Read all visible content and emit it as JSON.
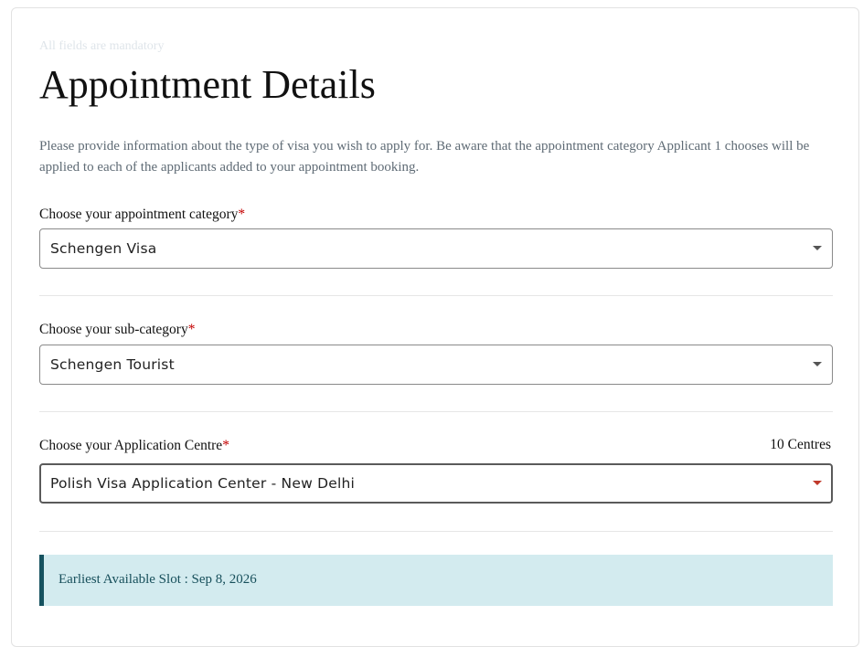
{
  "form": {
    "mandatory_note": "All fields are mandatory",
    "title": "Appointment Details",
    "intro": "Please provide information about the type of visa you wish to apply for. Be aware that the appointment category Applicant 1 chooses will be applied to each of the applicants added to your appointment booking.",
    "required_marker": "*"
  },
  "category": {
    "label": "Choose your appointment category",
    "value": "Schengen Visa"
  },
  "subcategory": {
    "label": "Choose your sub-category",
    "value": "Schengen Tourist"
  },
  "centre": {
    "label": "Choose your Application Centre",
    "count": "10 Centres",
    "value": "Polish Visa Application Center - New Delhi"
  },
  "slot": {
    "text": "Earliest Available Slot : Sep 8, 2026"
  },
  "colors": {
    "required": "#c40000",
    "slot_background": "#d3ebef",
    "slot_accent": "#16525f",
    "focused_caret": "#c0392b"
  },
  "icons": {
    "dropdown": "caret-down-icon"
  }
}
